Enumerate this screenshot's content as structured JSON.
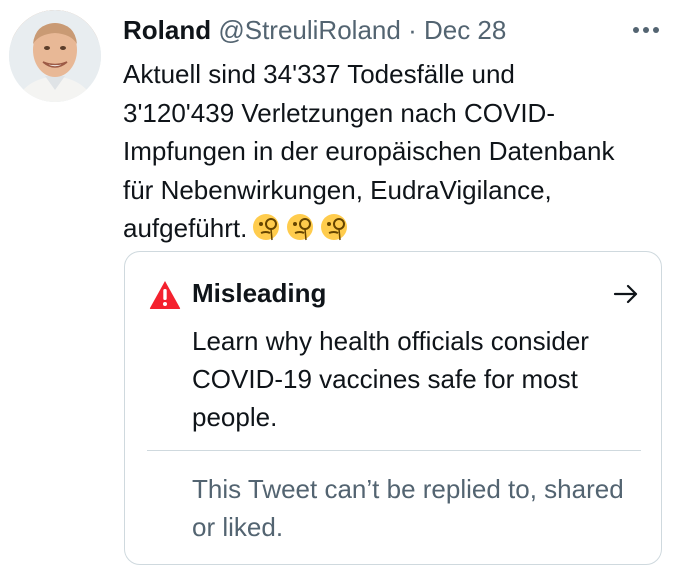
{
  "author": {
    "name": "Roland",
    "handle": "@StreuliRoland",
    "separator": "·",
    "date": "Dec 28"
  },
  "more_icon": "more-horizontal-icon",
  "tweet": {
    "text": "Aktuell sind 34'337 Todesfälle und\n3'120'439 Verletzungen nach COVID-\nImpfungen in der europäischen Datenbank\nfür Nebenwirkungen, EudraVigilance,\naufgeführt.",
    "emojis": [
      "face-with-monocle",
      "face-with-monocle",
      "face-with-monocle"
    ]
  },
  "misleading_card": {
    "title": "Misleading",
    "body": "Learn why health officials consider COVID-19 vaccines safe for most people.",
    "notice": "This Tweet can’t be replied to, shared or liked.",
    "warning_color": "#f4212e",
    "icons": [
      "warning-icon",
      "arrow-right-icon"
    ]
  }
}
